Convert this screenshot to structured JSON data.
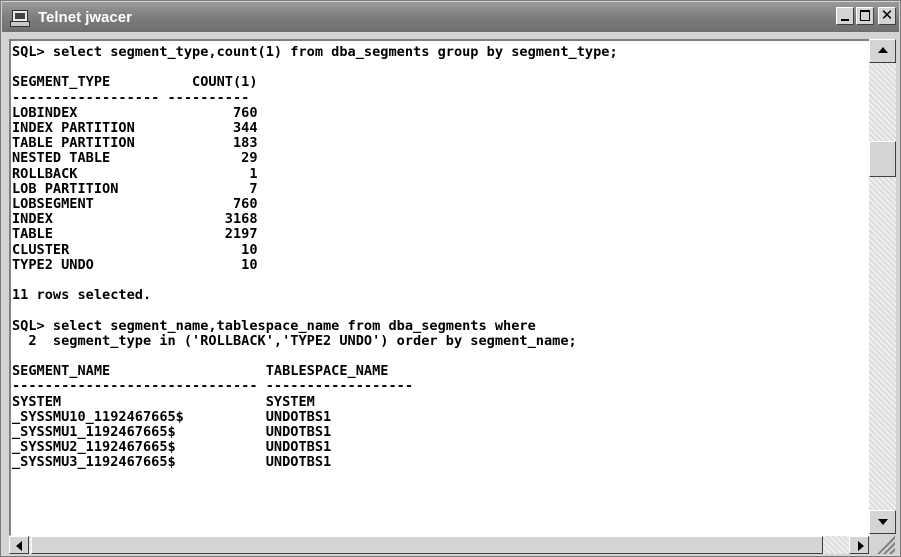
{
  "window": {
    "title": "Telnet jwacer",
    "icon": "telnet-monitor-icon"
  },
  "console": {
    "text": "SQL> select segment_type,count(1) from dba_segments group by segment_type;\n\nSEGMENT_TYPE          COUNT(1)\n------------------ ----------\nLOBINDEX                   760\nINDEX PARTITION            344\nTABLE PARTITION            183\nNESTED TABLE                29\nROLLBACK                     1\nLOB PARTITION                7\nLOBSEGMENT                 760\nINDEX                     3168\nTABLE                     2197\nCLUSTER                     10\nTYPE2 UNDO                  10\n\n11 rows selected.\n\nSQL> select segment_name,tablespace_name from dba_segments where\n  2  segment_type in ('ROLLBACK','TYPE2 UNDO') order by segment_name;\n\nSEGMENT_NAME                   TABLESPACE_NAME\n------------------------------ ------------------\nSYSTEM                         SYSTEM\n_SYSSMU10_1192467665$          UNDOTBS1\n_SYSSMU1_1192467665$           UNDOTBS1\n_SYSSMU2_1192467665$           UNDOTBS1\n_SYSSMU3_1192467665$           UNDOTBS1"
  },
  "scrollbars": {
    "vertical_position_fraction": 0.22,
    "horizontal_position_fraction": 0.0
  }
}
